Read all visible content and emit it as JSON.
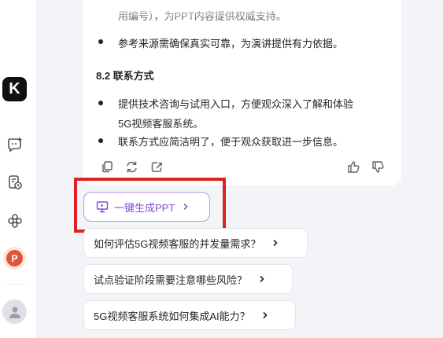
{
  "sidebar": {
    "logo_letter": "K",
    "icons": [
      "new-chat-icon",
      "history-icon",
      "apps-icon",
      "ppt-app-icon",
      "avatar-icon"
    ],
    "ppt_letter": "P"
  },
  "message": {
    "faded_line_1": "用编号），为PPT内容提供权威支持。",
    "bullet_source": "参考来源需确保真实可靠，为演讲提供有力依据。",
    "section_heading": "8.2 联系方式",
    "bullet_contact_1a": "提供技术咨询与试用入口，方便观众深入了解和体验",
    "bullet_contact_1b": "5G视频客服系统。",
    "bullet_contact_2": "联系方式应简洁明了，便于观众获取进一步信息。"
  },
  "actions": {
    "icons": [
      "copy-icon",
      "regenerate-icon",
      "share-icon",
      "thumbs-up-icon",
      "thumbs-down-icon"
    ]
  },
  "generate_ppt": {
    "label": "一键生成PPT",
    "accent": "#7f4bd6",
    "border": "#b892ef"
  },
  "highlight_color": "#e02020",
  "suggestions": [
    {
      "text": "如何评估5G视频客服的并发量需求？"
    },
    {
      "text": "试点验证阶段需要注意哪些风险？"
    },
    {
      "text": "5G视频客服系统如何集成AI能力？"
    }
  ]
}
